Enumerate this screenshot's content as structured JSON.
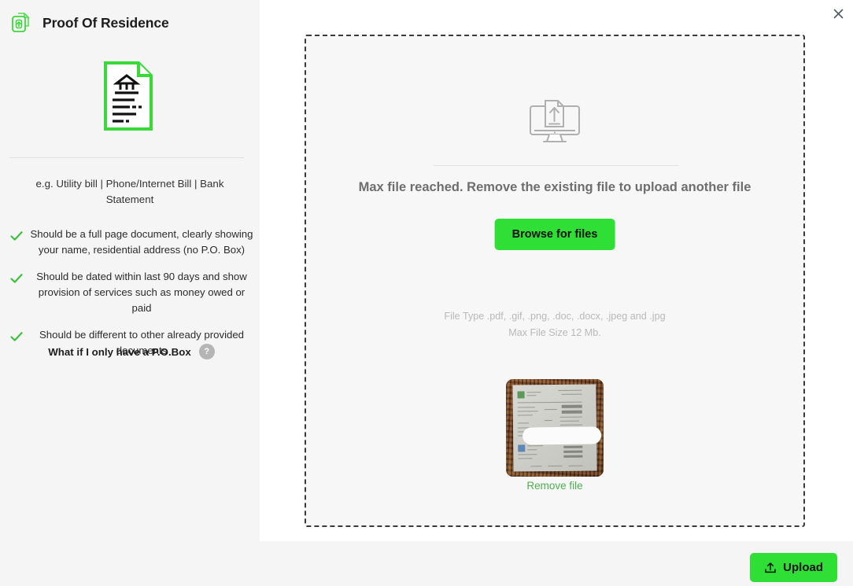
{
  "colors": {
    "accent_green": "#2fdf35",
    "check_green": "#3cc13c",
    "remove_link_green": "#4caf50",
    "panel_bg": "#f5f5f5",
    "content_bg": "#ffffff",
    "dropzone_bg": "#f7f7f7",
    "dropzone_border": "#3a3a3a",
    "muted_text": "#b9b9b9",
    "heading_text": "#6e6e6e"
  },
  "left_panel": {
    "icon_name": "document-upload-icon",
    "title": "Proof Of Residence",
    "hero_icon_name": "residence-document-icon",
    "examples": "e.g. Utility bill | Phone/Internet Bill | Bank Statement",
    "criteria": [
      {
        "icon_name": "check-icon",
        "text": "Should be a full page document, clearly showing your name, residential address (no P.O. Box)"
      },
      {
        "icon_name": "check-icon",
        "text": "Should be dated within last 90 days and show provision of services such as money owed or paid"
      },
      {
        "icon_name": "check-icon",
        "text": "Should be different to other already provided documents"
      }
    ],
    "pobox_label": "What if I only have a P.O.Box",
    "pobox_help_glyph": "?"
  },
  "right_panel": {
    "close_label": "×",
    "dropzone": {
      "icon_name": "monitor-upload-icon",
      "message": "Max file reached. Remove the existing file to upload another file",
      "browse_label": "Browse for files",
      "file_type_hint": "File Type .pdf, .gif, .png, .doc, .docx, .jpeg and .jpg",
      "file_size_hint": "Max File Size 12 Mb.",
      "thumbnail": {
        "name": "uploaded-document-thumbnail",
        "remove_label": "Remove file"
      }
    }
  },
  "footer": {
    "upload_label": "Upload",
    "upload_icon_name": "upload-icon"
  }
}
